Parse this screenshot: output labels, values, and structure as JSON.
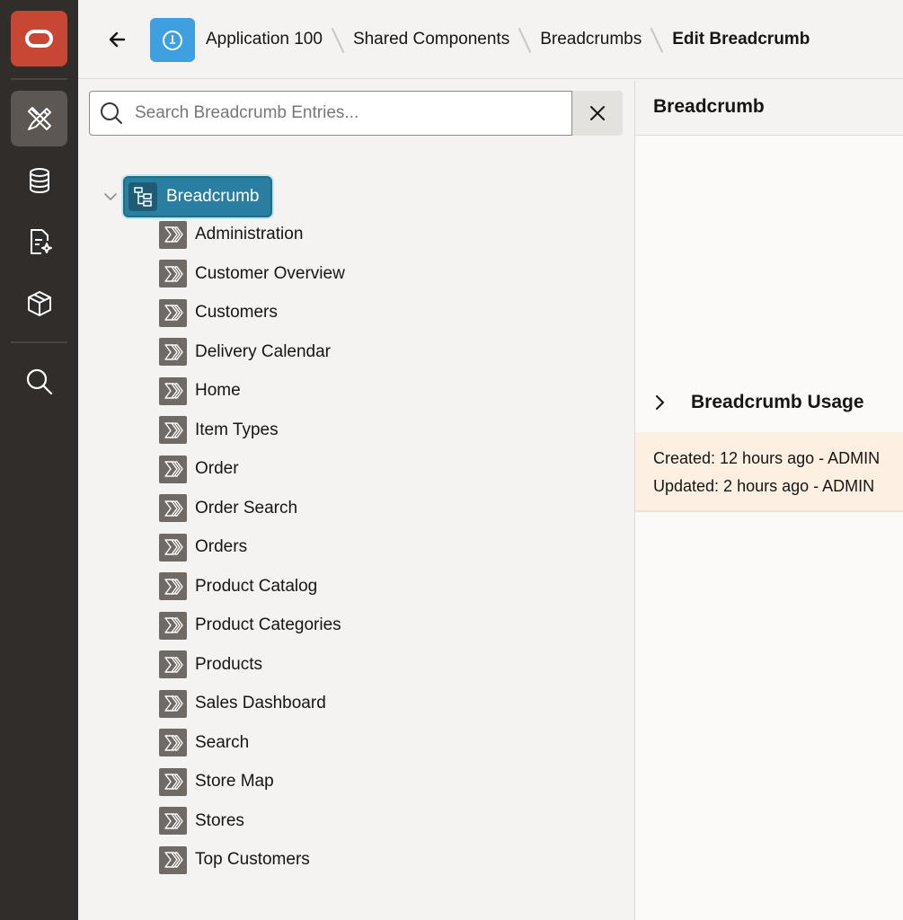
{
  "rail": {
    "logo": "oracle-logo",
    "items": [
      {
        "icon": "app-builder-icon",
        "active": true
      },
      {
        "icon": "database-icon",
        "active": false
      },
      {
        "icon": "document-ai-icon",
        "active": false
      },
      {
        "icon": "package-icon",
        "active": false
      },
      {
        "icon": "search-icon",
        "active": false
      }
    ]
  },
  "header": {
    "back_icon": "back-arrow-icon",
    "app_icon": "application-icon",
    "breadcrumbs": [
      "Application 100",
      "Shared Components",
      "Breadcrumbs",
      "Edit Breadcrumb"
    ]
  },
  "search": {
    "placeholder": "Search Breadcrumb Entries...",
    "value": ""
  },
  "tree": {
    "root": {
      "label": "Breadcrumb",
      "expanded": true
    },
    "entries": [
      "Administration",
      "Customer Overview",
      "Customers",
      "Delivery Calendar",
      "Home",
      "Item Types",
      "Order",
      "Order Search",
      "Orders",
      "Product Catalog",
      "Product Categories",
      "Products",
      "Sales Dashboard",
      "Search",
      "Store Map",
      "Stores",
      "Top Customers"
    ]
  },
  "properties": {
    "title": "Breadcrumb",
    "usage_label": "Breadcrumb Usage",
    "created": "Created: 12 hours ago - ADMIN",
    "updated": "Updated: 2 hours ago - ADMIN"
  },
  "colors": {
    "rail": "#312d2a",
    "logo": "#c74634",
    "selected_node": "#2a7fa1",
    "app_icon": "#3fa0e0",
    "audit_bg": "#fdf0e3"
  }
}
